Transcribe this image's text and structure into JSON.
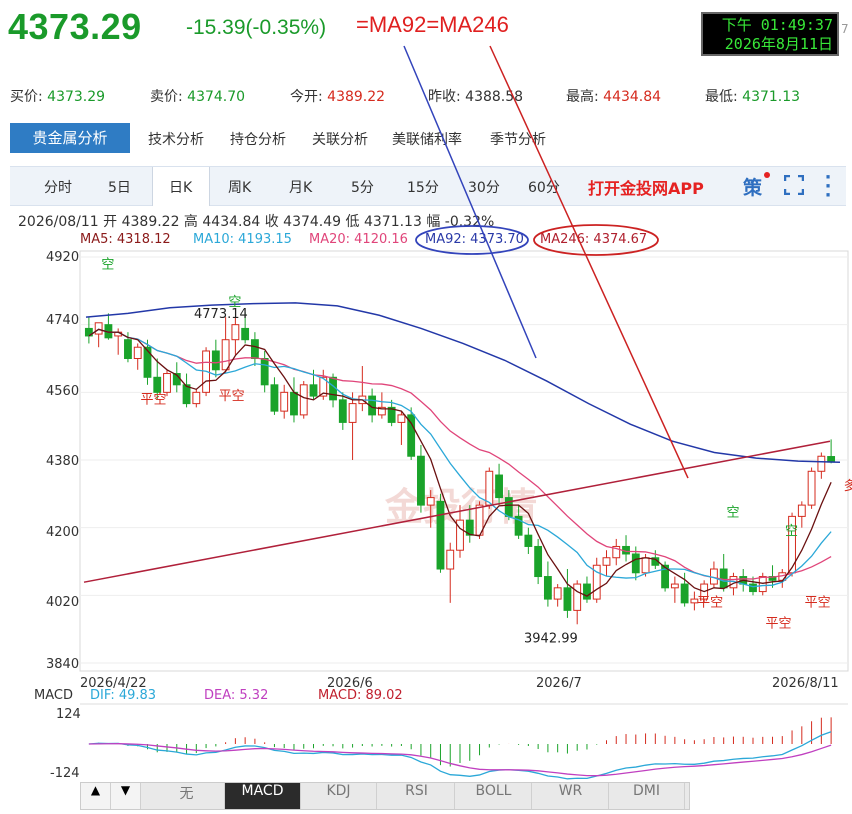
{
  "header": {
    "price": "4373.29",
    "change": "-15.39(-0.35%)",
    "ma_note": "=MA92=MA246",
    "clock_line1": "下午 01:49:37",
    "clock_line2": "2026年8月11日",
    "clock_edge": "7"
  },
  "quote": {
    "bid_label": "买价:",
    "bid": "4373.29",
    "ask_label": "卖价:",
    "ask": "4374.70",
    "open_label": "今开:",
    "open": "4389.22",
    "prev_label": "昨收:",
    "prev": "4388.58",
    "high_label": "最高:",
    "high": "4434.84",
    "low_label": "最低:",
    "low": "4371.13"
  },
  "nav": {
    "active": "贵金属分析",
    "items": [
      "技术分析",
      "持仓分析",
      "关联分析",
      "美联储利率",
      "季节分析"
    ]
  },
  "tabs": {
    "items": [
      "分时",
      "5日",
      "日K",
      "周K",
      "月K",
      "5分",
      "15分",
      "30分",
      "60分"
    ],
    "active": "日K",
    "app_link": "打开金投网APP",
    "ce_label": "策"
  },
  "ohlc_line": "2026/08/11 开 4389.22 高 4434.84 收 4374.49 低 4371.13 幅 -0.32%",
  "ma_legend": [
    {
      "label": "MA5: 4318.12",
      "color": "#8b1a1a"
    },
    {
      "label": "MA10: 4193.15",
      "color": "#2ba8d8"
    },
    {
      "label": "MA20: 4120.16",
      "color": "#e0457a"
    },
    {
      "label": "MA92: 4373.70",
      "color": "#2a3aa8"
    },
    {
      "label": "MA246: 4374.67",
      "color": "#b0202e"
    }
  ],
  "colors": {
    "up": "#d52b1e",
    "down": "#1aa32a",
    "ma5": "#6a1010",
    "ma10": "#2ba8d8",
    "ma20": "#e0457a",
    "ma92": "#2338a8",
    "ma246": "#b0203a",
    "dif": "#2ba8d8",
    "dea": "#c040c0"
  },
  "macd_legend": {
    "title": "MACD",
    "dif": "DIF: 49.83",
    "dea": "DEA: 5.32",
    "macd": "MACD: 89.02"
  },
  "indicator_bar": {
    "buttons": [
      "无",
      "MACD",
      "KDJ",
      "RSI",
      "BOLL",
      "WR",
      "DMI"
    ],
    "active": "MACD",
    "up_arrow": "▲",
    "down_arrow": "▼"
  },
  "chart_data": {
    "type": "candlestick",
    "y_ticks": [
      "4920",
      "4740",
      "4560",
      "4380",
      "4200",
      "4020",
      "3840"
    ],
    "ylim": [
      3840,
      4920
    ],
    "x_ticks": [
      "2026/4/22",
      "2026/6",
      "2026/7",
      "2026/8/11"
    ],
    "macd_y_ticks": [
      "124",
      "-124"
    ],
    "candles": [
      {
        "o": 4730,
        "h": 4760,
        "l": 4690,
        "c": 4710
      },
      {
        "o": 4715,
        "h": 4745,
        "l": 4680,
        "c": 4745
      },
      {
        "o": 4740,
        "h": 4770,
        "l": 4700,
        "c": 4705
      },
      {
        "o": 4710,
        "h": 4730,
        "l": 4660,
        "c": 4720
      },
      {
        "o": 4700,
        "h": 4720,
        "l": 4640,
        "c": 4650
      },
      {
        "o": 4650,
        "h": 4690,
        "l": 4620,
        "c": 4680
      },
      {
        "o": 4680,
        "h": 4700,
        "l": 4580,
        "c": 4600
      },
      {
        "o": 4600,
        "h": 4650,
        "l": 4540,
        "c": 4560
      },
      {
        "o": 4560,
        "h": 4620,
        "l": 4550,
        "c": 4610
      },
      {
        "o": 4610,
        "h": 4640,
        "l": 4560,
        "c": 4580
      },
      {
        "o": 4580,
        "h": 4610,
        "l": 4520,
        "c": 4530
      },
      {
        "o": 4530,
        "h": 4570,
        "l": 4520,
        "c": 4560
      },
      {
        "o": 4560,
        "h": 4680,
        "l": 4550,
        "c": 4670
      },
      {
        "o": 4670,
        "h": 4700,
        "l": 4600,
        "c": 4620
      },
      {
        "o": 4620,
        "h": 4760,
        "l": 4610,
        "c": 4700
      },
      {
        "o": 4700,
        "h": 4760,
        "l": 4660,
        "c": 4740
      },
      {
        "o": 4730,
        "h": 4773,
        "l": 4690,
        "c": 4700
      },
      {
        "o": 4700,
        "h": 4720,
        "l": 4630,
        "c": 4650
      },
      {
        "o": 4650,
        "h": 4670,
        "l": 4560,
        "c": 4580
      },
      {
        "o": 4580,
        "h": 4600,
        "l": 4500,
        "c": 4510
      },
      {
        "o": 4510,
        "h": 4580,
        "l": 4490,
        "c": 4560
      },
      {
        "o": 4560,
        "h": 4600,
        "l": 4480,
        "c": 4500
      },
      {
        "o": 4500,
        "h": 4590,
        "l": 4490,
        "c": 4580
      },
      {
        "o": 4580,
        "h": 4620,
        "l": 4540,
        "c": 4550
      },
      {
        "o": 4550,
        "h": 4620,
        "l": 4540,
        "c": 4600
      },
      {
        "o": 4600,
        "h": 4610,
        "l": 4520,
        "c": 4540
      },
      {
        "o": 4540,
        "h": 4560,
        "l": 4460,
        "c": 4480
      },
      {
        "o": 4480,
        "h": 4560,
        "l": 4380,
        "c": 4530
      },
      {
        "o": 4530,
        "h": 4630,
        "l": 4510,
        "c": 4550
      },
      {
        "o": 4550,
        "h": 4570,
        "l": 4480,
        "c": 4500
      },
      {
        "o": 4500,
        "h": 4560,
        "l": 4490,
        "c": 4520
      },
      {
        "o": 4520,
        "h": 4540,
        "l": 4470,
        "c": 4480
      },
      {
        "o": 4480,
        "h": 4510,
        "l": 4420,
        "c": 4500
      },
      {
        "o": 4500,
        "h": 4520,
        "l": 4380,
        "c": 4390
      },
      {
        "o": 4390,
        "h": 4420,
        "l": 4240,
        "c": 4260
      },
      {
        "o": 4260,
        "h": 4300,
        "l": 4200,
        "c": 4280
      },
      {
        "o": 4270,
        "h": 4290,
        "l": 4080,
        "c": 4090
      },
      {
        "o": 4090,
        "h": 4160,
        "l": 4000,
        "c": 4140
      },
      {
        "o": 4140,
        "h": 4260,
        "l": 4120,
        "c": 4220
      },
      {
        "o": 4220,
        "h": 4260,
        "l": 4160,
        "c": 4180
      },
      {
        "o": 4180,
        "h": 4270,
        "l": 4170,
        "c": 4260
      },
      {
        "o": 4260,
        "h": 4360,
        "l": 4250,
        "c": 4350
      },
      {
        "o": 4340,
        "h": 4370,
        "l": 4260,
        "c": 4280
      },
      {
        "o": 4280,
        "h": 4300,
        "l": 4220,
        "c": 4230
      },
      {
        "o": 4230,
        "h": 4260,
        "l": 4170,
        "c": 4180
      },
      {
        "o": 4180,
        "h": 4200,
        "l": 4130,
        "c": 4150
      },
      {
        "o": 4150,
        "h": 4170,
        "l": 4050,
        "c": 4070
      },
      {
        "o": 4070,
        "h": 4110,
        "l": 3990,
        "c": 4010
      },
      {
        "o": 4010,
        "h": 4050,
        "l": 3990,
        "c": 4040
      },
      {
        "o": 4040,
        "h": 4090,
        "l": 3960,
        "c": 3980
      },
      {
        "o": 3980,
        "h": 4060,
        "l": 3942.99,
        "c": 4050
      },
      {
        "o": 4050,
        "h": 4070,
        "l": 4000,
        "c": 4010
      },
      {
        "o": 4010,
        "h": 4120,
        "l": 4000,
        "c": 4100
      },
      {
        "o": 4100,
        "h": 4140,
        "l": 4070,
        "c": 4120
      },
      {
        "o": 4120,
        "h": 4170,
        "l": 4100,
        "c": 4150
      },
      {
        "o": 4150,
        "h": 4180,
        "l": 4110,
        "c": 4130
      },
      {
        "o": 4130,
        "h": 4150,
        "l": 4060,
        "c": 4080
      },
      {
        "o": 4080,
        "h": 4130,
        "l": 4070,
        "c": 4120
      },
      {
        "o": 4120,
        "h": 4140,
        "l": 4090,
        "c": 4100
      },
      {
        "o": 4100,
        "h": 4110,
        "l": 4030,
        "c": 4040
      },
      {
        "o": 4040,
        "h": 4070,
        "l": 4000,
        "c": 4050
      },
      {
        "o": 4050,
        "h": 4080,
        "l": 3990,
        "c": 4000
      },
      {
        "o": 4000,
        "h": 4030,
        "l": 3980,
        "c": 4010
      },
      {
        "o": 4010,
        "h": 4060,
        "l": 4000,
        "c": 4050
      },
      {
        "o": 4050,
        "h": 4110,
        "l": 4040,
        "c": 4090
      },
      {
        "o": 4090,
        "h": 4130,
        "l": 4030,
        "c": 4040
      },
      {
        "o": 4040,
        "h": 4080,
        "l": 4020,
        "c": 4070
      },
      {
        "o": 4070,
        "h": 4090,
        "l": 4030,
        "c": 4050
      },
      {
        "o": 4050,
        "h": 4070,
        "l": 4020,
        "c": 4030
      },
      {
        "o": 4030,
        "h": 4080,
        "l": 4020,
        "c": 4070
      },
      {
        "o": 4070,
        "h": 4100,
        "l": 4040,
        "c": 4060
      },
      {
        "o": 4060,
        "h": 4090,
        "l": 4040,
        "c": 4080
      },
      {
        "o": 4080,
        "h": 4240,
        "l": 4070,
        "c": 4230
      },
      {
        "o": 4230,
        "h": 4270,
        "l": 4200,
        "c": 4260
      },
      {
        "o": 4260,
        "h": 4360,
        "l": 4250,
        "c": 4350
      },
      {
        "o": 4350,
        "h": 4400,
        "l": 4330,
        "c": 4390
      },
      {
        "o": 4389.22,
        "h": 4434.84,
        "l": 4371.13,
        "c": 4374.49
      }
    ],
    "ma92": [
      4760,
      4770,
      4785,
      4792,
      4796,
      4798,
      4790,
      4765,
      4730,
      4690,
      4645,
      4590,
      4530,
      4475,
      4430,
      4400,
      4385,
      4377,
      4374
    ],
    "ma246": [
      4055,
      4430
    ],
    "annotations": [
      {
        "text": "4773.14",
        "value": 4773.14
      },
      {
        "text": "3942.99",
        "value": 3942.99
      },
      {
        "text": "空"
      },
      {
        "text": "平空"
      },
      {
        "text": "空"
      },
      {
        "text": "平空"
      },
      {
        "text": "空"
      },
      {
        "text": "平空"
      },
      {
        "text": "空"
      },
      {
        "text": "平空"
      },
      {
        "text": "平空"
      },
      {
        "text": "多"
      }
    ]
  }
}
